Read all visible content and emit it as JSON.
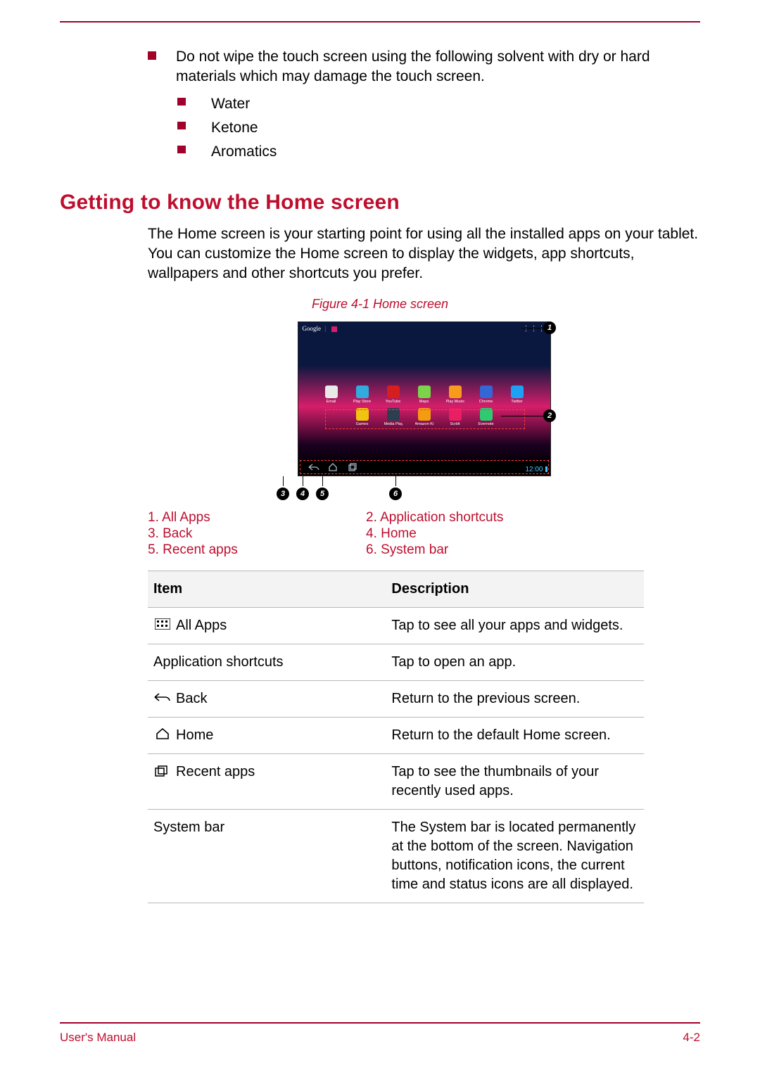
{
  "top_bullet": {
    "text": "Do not wipe the touch screen using the following solvent with dry or hard materials which may damage the touch screen.",
    "subitems": [
      "Water",
      "Ketone",
      "Aromatics"
    ]
  },
  "heading": "Getting to know the Home screen",
  "intro": "The Home screen is your starting point for using all the installed apps on your tablet. You can customize the Home screen to display the widgets, app shortcuts, wallpapers and other shortcuts you prefer.",
  "figure_caption": "Figure 4-1 Home screen",
  "screenshot": {
    "search_label": "Google",
    "clock": "12:00",
    "apps_row1": [
      {
        "name": "Email",
        "color": "#e8e8e8"
      },
      {
        "name": "Play Store",
        "color": "#33aadd"
      },
      {
        "name": "YouTube",
        "color": "#d61e1e"
      },
      {
        "name": "Maps",
        "color": "#7bd24b"
      },
      {
        "name": "Play Music",
        "color": "#f89b1c"
      },
      {
        "name": "Chrome",
        "color": "#3367d6"
      }
    ],
    "apps_row2": [
      {
        "name": "Twitter",
        "color": "#1da1f2"
      },
      {
        "name": "Games",
        "color": "#f1c40f"
      },
      {
        "name": "Media Player",
        "color": "#2c3e50"
      },
      {
        "name": "Amazon Kindle",
        "color": "#f39c12"
      },
      {
        "name": "Scrblt",
        "color": "#e91e63"
      },
      {
        "name": "Evernote",
        "color": "#2ecc71"
      }
    ]
  },
  "callouts": [
    "1",
    "2",
    "3",
    "4",
    "5",
    "6"
  ],
  "legend": {
    "c1": [
      "1. All Apps",
      "3. Back",
      "5. Recent apps"
    ],
    "c2": [
      "2. Application shortcuts",
      "4. Home",
      "6. System bar"
    ]
  },
  "table": {
    "h1": "Item",
    "h2": "Description",
    "rows": [
      {
        "icon": "allapps",
        "item": "All Apps",
        "desc": "Tap to see all your apps and widgets."
      },
      {
        "icon": "",
        "item": "Application shortcuts",
        "desc": "Tap to open an app."
      },
      {
        "icon": "back",
        "item": "Back",
        "desc": "Return to the previous screen."
      },
      {
        "icon": "home",
        "item": "Home",
        "desc": "Return to the default Home screen."
      },
      {
        "icon": "recent",
        "item": "Recent apps",
        "desc": "Tap to see the thumbnails of your recently used apps."
      },
      {
        "icon": "",
        "item": "System bar",
        "desc": "The System bar is located permanently at the bottom of the screen. Navigation buttons, notification icons, the current time and status icons are all displayed."
      }
    ]
  },
  "footer": {
    "left": "User's Manual",
    "right": "4-2"
  }
}
